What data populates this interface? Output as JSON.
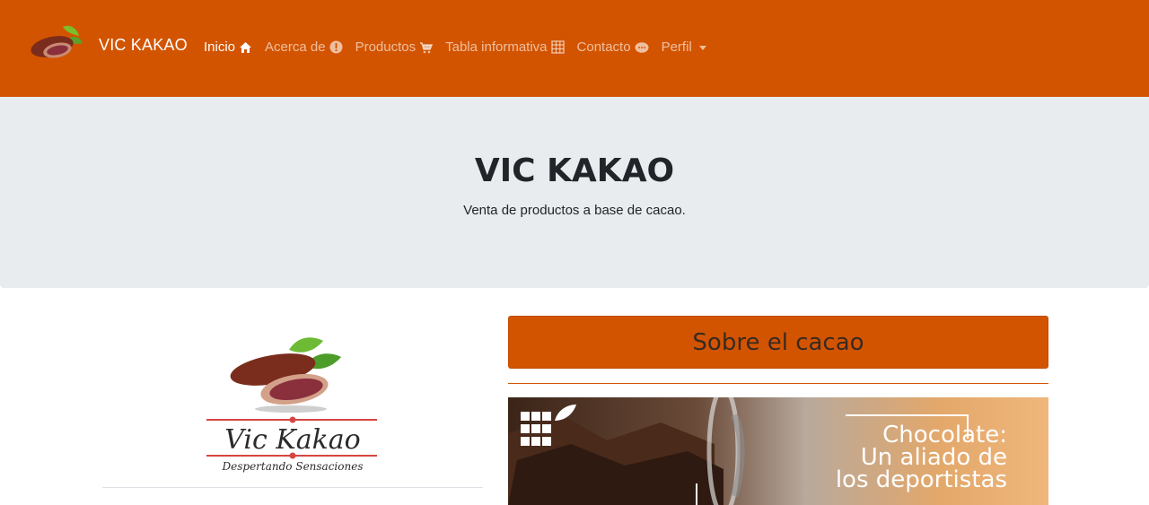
{
  "navbar": {
    "brand": "VIC KAKAO",
    "items": [
      {
        "label": "Inicio",
        "icon": "home-icon",
        "active": true
      },
      {
        "label": "Acerca de",
        "icon": "info-icon"
      },
      {
        "label": "Productos",
        "icon": "cart-icon"
      },
      {
        "label": "Tabla informativa",
        "icon": "table-icon"
      },
      {
        "label": "Contacto",
        "icon": "chat-icon"
      },
      {
        "label": "Perfil",
        "icon": "caret-down-icon"
      }
    ],
    "color": "#d35400"
  },
  "hero": {
    "title": "VIC KAKAO",
    "subtitle": "Venta de productos a base de cacao."
  },
  "logo": {
    "name": "Vic Kakao",
    "tagline": "Despertando Sensaciones"
  },
  "section": {
    "title": "Sobre el cacao"
  },
  "banner": {
    "line1": "Chocolate:",
    "line2": "Un aliado de",
    "line3": "los deportistas"
  }
}
